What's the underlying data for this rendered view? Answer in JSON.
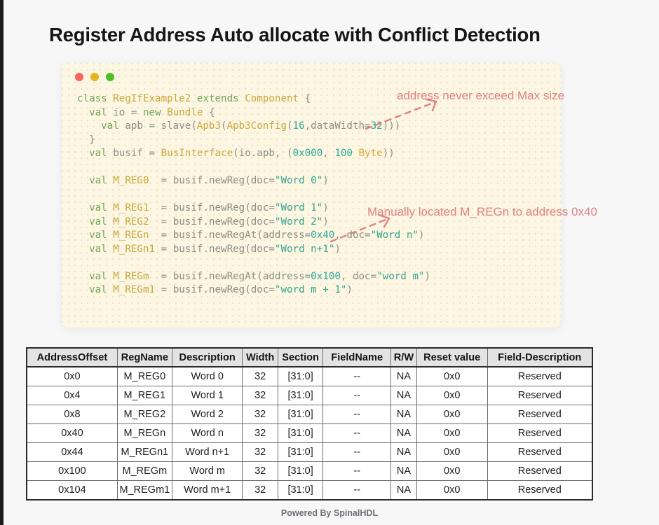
{
  "slide": {
    "title": "Register Address Auto allocate with Conflict Detection",
    "footer": "Powered By SpinalHDL",
    "background_color": "#f7f7f7"
  },
  "code_panel": {
    "background_color": "#fcf6e3",
    "window_dots": [
      {
        "name": "close-dot",
        "color": "#f9655b"
      },
      {
        "name": "minimize-dot",
        "color": "#e3b51f"
      },
      {
        "name": "maximize-dot",
        "color": "#4fc028"
      }
    ],
    "language": "scala",
    "lines": [
      "class RegIfExample2 extends Component {",
      "  val io = new Bundle {",
      "    val apb = slave(Apb3(Apb3Config(16,dataWidth=32)))",
      "  }",
      "  val busif = BusInterface(io.apb, (0x000, 100 Byte))",
      "",
      "  val M_REG0  = busif.newReg(doc=\"Word 0\")",
      "",
      "  val M_REG1  = busif.newReg(doc=\"Word 1\")",
      "  val M_REG2  = busif.newReg(doc=\"Word 2\")",
      "  val M_REGn  = busif.newRegAt(address=0x40, doc=\"Word n\")",
      "  val M_REGn1 = busif.newReg(doc=\"Word n+1\")",
      "",
      "  val M_REGm  = busif.newRegAt(address=0x100, doc=\"word m\")",
      "  val M_REGm1 = busif.newReg(doc=\"word m + 1\")"
    ]
  },
  "annotations": {
    "color": "#e0817f",
    "items": [
      {
        "id": "max-size-note",
        "text": "address never exceed Max size"
      },
      {
        "id": "manual-address-note",
        "text": "Manually located M_REGn to address 0x40"
      }
    ]
  },
  "register_table": {
    "headers": [
      "AddressOffset",
      "RegName",
      "Description",
      "Width",
      "Section",
      "FieldName",
      "R/W",
      "Reset value",
      "Field-Description"
    ],
    "rows": [
      {
        "address": "0x0",
        "regname": "M_REG0",
        "description": "Word 0",
        "width": "32",
        "section": "[31:0]",
        "fieldname": "--",
        "rw": "NA",
        "reset": "0x0",
        "field_description": "Reserved"
      },
      {
        "address": "0x4",
        "regname": "M_REG1",
        "description": "Word 1",
        "width": "32",
        "section": "[31:0]",
        "fieldname": "--",
        "rw": "NA",
        "reset": "0x0",
        "field_description": "Reserved"
      },
      {
        "address": "0x8",
        "regname": "M_REG2",
        "description": "Word 2",
        "width": "32",
        "section": "[31:0]",
        "fieldname": "--",
        "rw": "NA",
        "reset": "0x0",
        "field_description": "Reserved"
      },
      {
        "address": "0x40",
        "regname": "M_REGn",
        "description": "Word n",
        "width": "32",
        "section": "[31:0]",
        "fieldname": "--",
        "rw": "NA",
        "reset": "0x0",
        "field_description": "Reserved"
      },
      {
        "address": "0x44",
        "regname": "M_REGn1",
        "description": "Word n+1",
        "width": "32",
        "section": "[31:0]",
        "fieldname": "--",
        "rw": "NA",
        "reset": "0x0",
        "field_description": "Reserved"
      },
      {
        "address": "0x100",
        "regname": "M_REGm",
        "description": "Word m",
        "width": "32",
        "section": "[31:0]",
        "fieldname": "--",
        "rw": "NA",
        "reset": "0x0",
        "field_description": "Reserved"
      },
      {
        "address": "0x104",
        "regname": "M_REGm1",
        "description": "Word m+1",
        "width": "32",
        "section": "[31:0]",
        "fieldname": "--",
        "rw": "NA",
        "reset": "0x0",
        "field_description": "Reserved"
      }
    ]
  }
}
